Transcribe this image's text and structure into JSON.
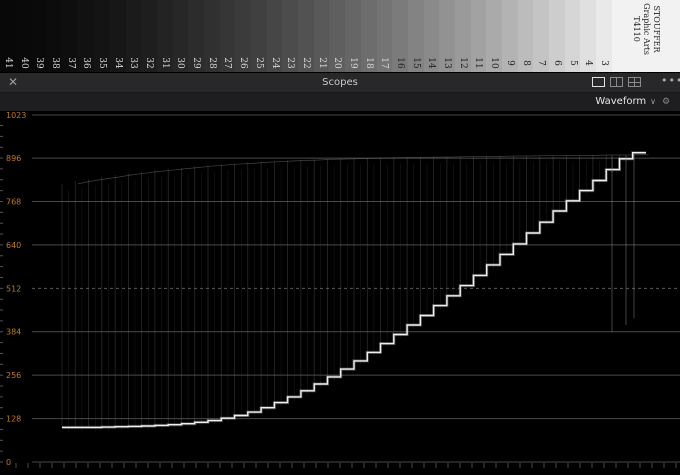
{
  "wedge": {
    "step_numbers": [
      "41",
      "40",
      "39",
      "38",
      "37",
      "36",
      "35",
      "34",
      "33",
      "32",
      "31",
      "30",
      "29",
      "28",
      "27",
      "26",
      "25",
      "24",
      "23",
      "22",
      "21",
      "20",
      "19",
      "18",
      "17",
      "16",
      "15",
      "14",
      "13",
      "12",
      "11",
      "10",
      "9",
      "8",
      "7",
      "6",
      "5",
      "4",
      "3"
    ],
    "label_line1": "STOUFFER",
    "label_line2": "Graphic Arts",
    "label_line3": "T4110"
  },
  "panel": {
    "title": "Scopes",
    "close_icon": "close-icon",
    "layout_icons": [
      "single-view-icon",
      "dual-view-icon",
      "quad-view-icon"
    ],
    "more_icon": "ellipsis-icon"
  },
  "toolbar": {
    "scope_type": "Waveform",
    "settings_icon": "settings-icon"
  },
  "chart_data": {
    "type": "line",
    "title": "",
    "xlabel": "",
    "ylabel": "",
    "ylim": [
      0,
      1023
    ],
    "y_ticks": [
      "1023",
      "896",
      "768",
      "640",
      "512",
      "384",
      "256",
      "128",
      "0"
    ],
    "y_tick_values": [
      1023,
      896,
      768,
      640,
      512,
      384,
      256,
      128,
      0
    ],
    "dashed_reference_value": 512,
    "grid": true,
    "series": [
      {
        "steps": [
          102,
          102,
          102,
          103,
          104,
          105,
          106,
          108,
          110,
          113,
          117,
          122,
          129,
          137,
          147,
          160,
          175,
          192,
          210,
          230,
          251,
          274,
          298,
          323,
          349,
          376,
          404,
          432,
          461,
          490,
          520,
          550,
          581,
          612,
          643,
          675,
          707,
          740,
          770,
          800,
          830,
          862,
          894,
          912
        ]
      }
    ],
    "top_trace_values": [
      820,
      828,
      834,
      840,
      846,
      851,
      856,
      860,
      864,
      868,
      872,
      875,
      878,
      880,
      883,
      885,
      887,
      889,
      890,
      892,
      893,
      894,
      895,
      896,
      897,
      898,
      898,
      899,
      899,
      900,
      900,
      901,
      901,
      902,
      902,
      903,
      903,
      904,
      904,
      904,
      905,
      905,
      905,
      906
    ]
  }
}
